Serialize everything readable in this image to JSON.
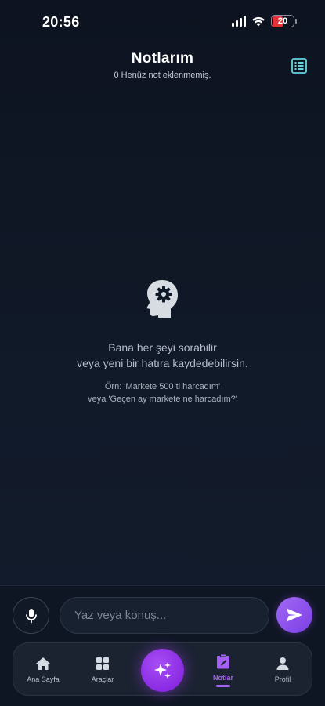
{
  "status_bar": {
    "time": "20:56",
    "battery": "20",
    "battery_color": "#e0333a"
  },
  "header": {
    "title": "Notlarım",
    "subtitle": "0 Henüz not eklenmemiş.",
    "list_icon": "list-icon",
    "accent": "#62d6e0"
  },
  "empty_state": {
    "icon": "head-gear-icon",
    "line1": "Bana her şeyi sorabilir",
    "line2": "veya yeni bir hatıra kaydedebilirsin.",
    "example1": "Örn: 'Markete 500 tl harcadım'",
    "example2": "veya 'Geçen ay markete ne harcadım?'"
  },
  "composer": {
    "placeholder": "Yaz veya konuş...",
    "mic_icon": "microphone-icon",
    "send_icon": "send-icon"
  },
  "tabs": [
    {
      "label": "Ana Sayfa",
      "icon": "home-icon",
      "active": false
    },
    {
      "label": "Araçlar",
      "icon": "grid-icon",
      "active": false
    },
    {
      "label": "",
      "icon": "sparkles-icon",
      "active": false
    },
    {
      "label": "Notlar",
      "icon": "clipboard-edit-icon",
      "active": true
    },
    {
      "label": "Profil",
      "icon": "person-icon",
      "active": false
    }
  ],
  "colors": {
    "accent_purple": "#a560f4",
    "background": "#0d1320"
  }
}
